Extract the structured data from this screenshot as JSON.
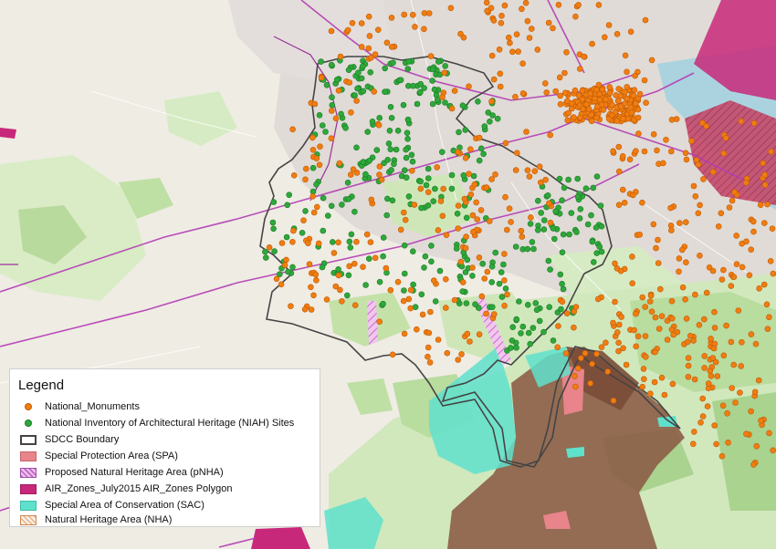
{
  "legend": {
    "title": "Legend",
    "items": [
      {
        "label": "National_Monuments",
        "symbol": "dot",
        "color": "#f07d12"
      },
      {
        "label": "National Inventory of Architectural Heritage (NIAH) Sites",
        "symbol": "dot",
        "color": "#2ea83a"
      },
      {
        "label": "SDCC Boundary",
        "symbol": "outline",
        "color": "#444444"
      },
      {
        "label": "Special Protection Area (SPA)",
        "symbol": "fill",
        "color": "#e8848a"
      },
      {
        "label": "Proposed Natural Heritage Area (pNHA)",
        "symbol": "hatch",
        "color": "#c070c8"
      },
      {
        "label": "AIR_Zones_July2015 AIR_Zones Polygon",
        "symbol": "fill",
        "color": "#c8287a"
      },
      {
        "label": "Special Area of Conservation (SAC)",
        "symbol": "fill",
        "color": "#5fe0cc"
      },
      {
        "label": "Natural Heritage Area (NHA)",
        "symbol": "hatch-outline",
        "color": "#e0a070"
      }
    ]
  },
  "colors": {
    "basemap": "#efece4",
    "urban": "#ddd8d3",
    "greenery": "#cfe7b8",
    "mountains": "#8a5a44",
    "roads": "#b43cb4",
    "monuments": "#f07d12",
    "niah": "#2ea83a",
    "boundary": "#444444"
  }
}
